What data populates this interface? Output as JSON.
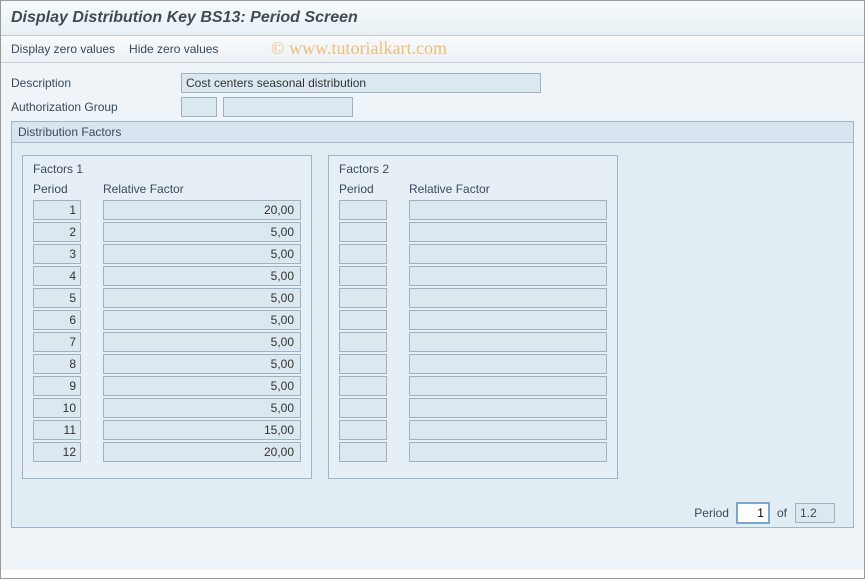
{
  "header": {
    "title": "Display Distribution Key BS13: Period Screen"
  },
  "toolbar": {
    "display_zero": "Display zero values",
    "hide_zero": "Hide zero values"
  },
  "watermark": "© www.tutorialkart.com",
  "fields": {
    "description_label": "Description",
    "description_value": "Cost centers seasonal distribution",
    "auth_group_label": "Authorization Group",
    "auth_group_val1": "",
    "auth_group_val2": ""
  },
  "groupbox": {
    "title": "Distribution Factors",
    "factors1": {
      "title": "Factors 1",
      "col_period": "Period",
      "col_relfactor": "Relative Factor",
      "rows": [
        {
          "period": "1",
          "factor": "20,00"
        },
        {
          "period": "2",
          "factor": "5,00"
        },
        {
          "period": "3",
          "factor": "5,00"
        },
        {
          "period": "4",
          "factor": "5,00"
        },
        {
          "period": "5",
          "factor": "5,00"
        },
        {
          "period": "6",
          "factor": "5,00"
        },
        {
          "period": "7",
          "factor": "5,00"
        },
        {
          "period": "8",
          "factor": "5,00"
        },
        {
          "period": "9",
          "factor": "5,00"
        },
        {
          "period": "10",
          "factor": "5,00"
        },
        {
          "period": "11",
          "factor": "15,00"
        },
        {
          "period": "12",
          "factor": "20,00"
        }
      ]
    },
    "factors2": {
      "title": "Factors 2",
      "col_period": "Period",
      "col_relfactor": "Relative Factor",
      "rows": [
        {
          "period": "",
          "factor": ""
        },
        {
          "period": "",
          "factor": ""
        },
        {
          "period": "",
          "factor": ""
        },
        {
          "period": "",
          "factor": ""
        },
        {
          "period": "",
          "factor": ""
        },
        {
          "period": "",
          "factor": ""
        },
        {
          "period": "",
          "factor": ""
        },
        {
          "period": "",
          "factor": ""
        },
        {
          "period": "",
          "factor": ""
        },
        {
          "period": "",
          "factor": ""
        },
        {
          "period": "",
          "factor": ""
        },
        {
          "period": "",
          "factor": ""
        }
      ]
    },
    "footer": {
      "period_label": "Period",
      "page_current": "1",
      "of_label": "of",
      "page_total": "1.2"
    }
  }
}
